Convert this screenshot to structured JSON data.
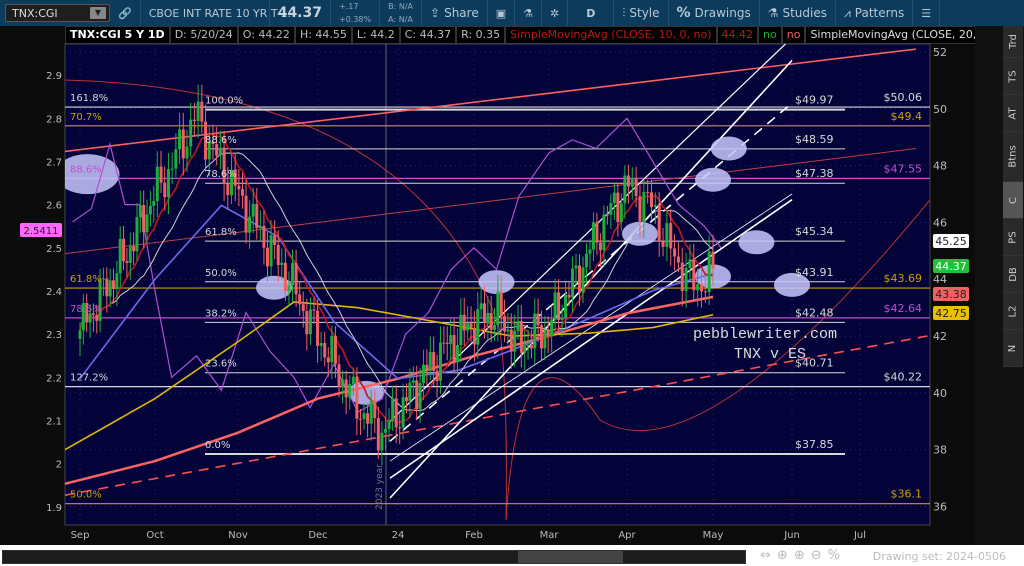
{
  "toolbar": {
    "symbol": "TNX:CGI",
    "description": "CBOE INT RATE 10 YR T-...",
    "last": "44.37",
    "change": "+.17",
    "change_pct": "+0.38%",
    "bid": "B: N/A",
    "ask": "A: N/A",
    "share": "Share",
    "period": "D",
    "style": "Style",
    "drawings": "Drawings",
    "studies": "Studies",
    "patterns": "Patterns"
  },
  "legend": {
    "title": "TNX:CGI 5 Y 1D",
    "date": "D: 5/20/24",
    "open": "O: 44.22",
    "high": "H: 44.55",
    "low": "L: 44.2",
    "close": "C: 44.37",
    "range": "R: 0.35",
    "sma10": "SimpleMovingAvg (CLOSE, 10, 0, no)",
    "sma10_val": "44.42",
    "no1": "no",
    "no2": "no",
    "sma20": "SimpleMovingAvg (CLOSE, 20, 0,..."
  },
  "sidebar_tabs": [
    "Trd",
    "TS",
    "AT",
    "Btns",
    "C",
    "PS",
    "DB",
    "L2",
    "N"
  ],
  "bottom": {
    "drawing_set": "Drawing set: 2024-0506"
  },
  "watermark": [
    "pebblewriter.com",
    "TNX v ES"
  ],
  "year_marker": "2023 year",
  "colors": {
    "bg": "#03033a",
    "up": "#1fae3a",
    "down": "#f06262",
    "sma10": "#c01818",
    "sma20": "#d0d0d0",
    "sma50": "#6a6af0",
    "sma100": "#e0b800",
    "sma200": "#ff6464",
    "es": "#b050d0",
    "fib": "#d8d8d8",
    "gold": "#c8a000",
    "purple": "#c050d0"
  },
  "chart_data": {
    "type": "candlestick",
    "x_ticks": [
      "Sep",
      "Oct",
      "Nov",
      "Dec",
      "24",
      "Feb",
      "Mar",
      "Apr",
      "May",
      "Jun",
      "Jul"
    ],
    "right_axis": {
      "ticks": [
        36,
        38,
        40,
        42,
        44,
        46,
        48,
        50,
        52
      ],
      "range": [
        35.35,
        52.28
      ]
    },
    "left_axis": {
      "ticks": [
        "1.9",
        "2",
        "2.1",
        "2.2",
        "2.3",
        "2.4",
        "2.5",
        "2.6",
        "2.7",
        "2.8",
        "2.9"
      ],
      "range": [
        1.858,
        2.972
      ],
      "marker": "2.5411"
    },
    "price_badges": [
      {
        "v": "45.25",
        "c": "#ffffff",
        "t": "#222"
      },
      {
        "v": "44.37",
        "c": "#22c03a",
        "t": "#fff"
      },
      {
        "v": "43.38",
        "c": "#f06262",
        "t": "#222"
      },
      {
        "v": "42.75",
        "c": "#e8c000",
        "t": "#222"
      }
    ],
    "price_path": [
      [
        0,
        42.2
      ],
      [
        0.3,
        43.5
      ],
      [
        0.6,
        44.8
      ],
      [
        0.9,
        46.5
      ],
      [
        1.2,
        48
      ],
      [
        1.5,
        49.8
      ],
      [
        1.7,
        48.5
      ],
      [
        2.0,
        47
      ],
      [
        2.3,
        45.5
      ],
      [
        2.6,
        44.2
      ],
      [
        2.9,
        42.5
      ],
      [
        3.2,
        41
      ],
      [
        3.5,
        39.5
      ],
      [
        3.8,
        38.6
      ],
      [
        4.0,
        39.3
      ],
      [
        4.3,
        40.5
      ],
      [
        4.6,
        41.5
      ],
      [
        5.0,
        42.5
      ],
      [
        5.3,
        42.8
      ],
      [
        5.6,
        41.7
      ],
      [
        6.0,
        42.3
      ],
      [
        6.3,
        43.8
      ],
      [
        6.7,
        46
      ],
      [
        7.0,
        47.3
      ],
      [
        7.3,
        46.5
      ],
      [
        7.5,
        45
      ],
      [
        7.8,
        43.7
      ],
      [
        8.0,
        44.37
      ]
    ],
    "sma50": [
      [
        0,
        40.5
      ],
      [
        1,
        44
      ],
      [
        1.8,
        46.6
      ],
      [
        2.5,
        45.5
      ],
      [
        3.2,
        42.5
      ],
      [
        4,
        40.5
      ],
      [
        4.8,
        40.8
      ],
      [
        5.5,
        41.5
      ],
      [
        6.5,
        42.6
      ],
      [
        7.3,
        43.6
      ],
      [
        8,
        44.2
      ]
    ],
    "sma100": [
      [
        -0.2,
        38
      ],
      [
        1,
        39.8
      ],
      [
        2,
        41.8
      ],
      [
        2.7,
        43.2
      ],
      [
        3.5,
        43
      ],
      [
        4.5,
        42.5
      ],
      [
        5.5,
        42
      ],
      [
        6.5,
        42.1
      ],
      [
        7.3,
        42.3
      ],
      [
        8,
        42.75
      ]
    ],
    "sma200": [
      [
        -0.2,
        36.8
      ],
      [
        1,
        37.6
      ],
      [
        2,
        38.6
      ],
      [
        3,
        39.8
      ],
      [
        4,
        40.5
      ],
      [
        5,
        41.3
      ],
      [
        6,
        42
      ],
      [
        7,
        42.8
      ],
      [
        8,
        43.38
      ]
    ],
    "es_line": [
      [
        -0.1,
        2.56
      ],
      [
        0.15,
        2.59
      ],
      [
        0.4,
        2.74
      ],
      [
        0.6,
        2.6
      ],
      [
        0.8,
        2.6
      ],
      [
        1.0,
        2.4
      ],
      [
        1.2,
        2.2
      ],
      [
        1.5,
        2.25
      ],
      [
        1.8,
        2.17
      ],
      [
        2.1,
        2.35
      ],
      [
        2.4,
        2.26
      ],
      [
        2.7,
        2.2
      ],
      [
        2.9,
        2.13
      ],
      [
        3.2,
        2.23
      ],
      [
        3.5,
        2.12
      ],
      [
        3.8,
        2.15
      ],
      [
        4.1,
        2.3
      ],
      [
        4.4,
        2.35
      ],
      [
        4.7,
        2.45
      ],
      [
        5.0,
        2.5
      ],
      [
        5.3,
        2.45
      ],
      [
        5.6,
        2.62
      ],
      [
        6.0,
        2.72
      ],
      [
        6.3,
        2.75
      ],
      [
        6.6,
        2.73
      ],
      [
        7.0,
        2.8
      ],
      [
        7.3,
        2.7
      ],
      [
        7.6,
        2.6
      ],
      [
        7.9,
        2.55
      ],
      [
        8.1,
        2.5
      ]
    ],
    "fib_short": [
      {
        "p": "100.0%",
        "v": 49.97,
        "l": "$49.97"
      },
      {
        "p": "88.6%",
        "v": 48.59,
        "l": "$48.59"
      },
      {
        "p": "78.6%",
        "v": 47.38,
        "l": "$47.38"
      },
      {
        "p": "61.8%",
        "v": 45.34,
        "l": "$45.34"
      },
      {
        "p": "50.0%",
        "v": 43.91,
        "l": "$43.91"
      },
      {
        "p": "38.2%",
        "v": 42.48,
        "l": "$42.48"
      },
      {
        "p": "23.6%",
        "v": 40.71,
        "l": "$40.71"
      },
      {
        "p": "0.0%",
        "v": 37.85,
        "l": "$37.85"
      }
    ],
    "fib_long": [
      {
        "p": "161.8%",
        "v": 50.06,
        "l": "$50.06",
        "c": "#d8d8d8"
      },
      {
        "p": "70.7%",
        "v": 49.4,
        "l": "$49.4",
        "c": "#c8a000"
      },
      {
        "p": "88.6%",
        "v": 47.55,
        "l": "$47.55",
        "c": "#c050d0"
      },
      {
        "p": "61.8%",
        "v": 43.69,
        "l": "$43.69",
        "c": "#c8a000"
      },
      {
        "p": "78.6%",
        "v": 42.64,
        "l": "$42.64",
        "c": "#c050d0"
      },
      {
        "p": "127.2%",
        "v": 40.22,
        "l": "$40.22",
        "c": "#d8d8d8"
      },
      {
        "p": "50.0%",
        "v": 36.1,
        "l": "$36.1",
        "c": "#c8a000"
      }
    ],
    "trendlines": [
      {
        "a": [
          -0.2,
          48.5
        ],
        "b": [
          10.8,
          52.1
        ],
        "c": "#ff6060",
        "w": 1.6
      },
      {
        "a": [
          -0.2,
          44.9
        ],
        "b": [
          10.8,
          48.6
        ],
        "c": "#c04040",
        "w": 1
      },
      {
        "a": [
          -0.2,
          36.4
        ],
        "b": [
          11.4,
          42.2
        ],
        "c": "#ff5050",
        "w": 1.6,
        "dash": true
      },
      {
        "a": [
          3.9,
          36.3
        ],
        "b": [
          9.0,
          51.7
        ],
        "c": "#ffffff",
        "w": 1.6
      },
      {
        "a": [
          3.9,
          39.0
        ],
        "b": [
          9.0,
          52.5
        ],
        "c": "#ffffff",
        "w": 1.2
      },
      {
        "a": [
          3.9,
          38.3
        ],
        "b": [
          9.0,
          50.2
        ],
        "c": "#ffffff",
        "w": 1.6,
        "dash": true
      },
      {
        "a": [
          3.9,
          37.6
        ],
        "b": [
          9.0,
          47.0
        ],
        "c": "#ffffff",
        "w": 0.8
      },
      {
        "a": [
          3.9,
          37.0
        ],
        "b": [
          9.0,
          46.8
        ],
        "c": "#ffffff",
        "w": 1.6
      }
    ],
    "highlights": [
      [
        0.1,
        47.7
      ],
      [
        2.45,
        43.7
      ],
      [
        3.6,
        40.0
      ],
      [
        5.3,
        43.9
      ],
      [
        7.15,
        45.6
      ],
      [
        8.2,
        48.6
      ],
      [
        8.0,
        47.5
      ],
      [
        8.55,
        45.3
      ],
      [
        8.0,
        44.1
      ],
      [
        9.0,
        43.8
      ]
    ]
  }
}
